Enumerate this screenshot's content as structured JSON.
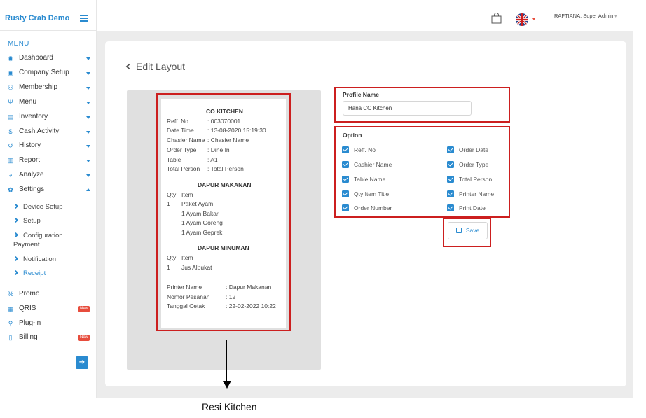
{
  "app": {
    "brand": "Rusty Crab Demo"
  },
  "sidebar": {
    "menu_title": "MENU",
    "items": [
      {
        "label": "Dashboard",
        "icon": "dashboard-icon"
      },
      {
        "label": "Company Setup",
        "icon": "building-icon"
      },
      {
        "label": "Membership",
        "icon": "users-icon"
      },
      {
        "label": "Menu",
        "icon": "cutlery-icon"
      },
      {
        "label": "Inventory",
        "icon": "inventory-icon"
      },
      {
        "label": "Cash Activity",
        "icon": "dollar-icon"
      },
      {
        "label": "History",
        "icon": "history-icon"
      },
      {
        "label": "Report",
        "icon": "report-icon"
      },
      {
        "label": "Analyze",
        "icon": "pie-chart-icon"
      },
      {
        "label": "Settings",
        "icon": "gear-icon"
      }
    ],
    "settings_sub": [
      "Device Setup",
      "Setup",
      "Configuration",
      "Payment",
      "Notification",
      "Receipt"
    ],
    "bottom_items": [
      {
        "label": "Promo",
        "icon": "percent-icon"
      },
      {
        "label": "QRIS",
        "icon": "qr-icon",
        "badge": "New"
      },
      {
        "label": "Plug-in",
        "icon": "plug-icon"
      },
      {
        "label": "Billing",
        "icon": "billing-icon",
        "badge": "New"
      }
    ]
  },
  "topbar": {
    "user": "RAFTIANA, Super Admin"
  },
  "page": {
    "title": "Edit Layout"
  },
  "receipt": {
    "title": "CO KITCHEN",
    "fields": [
      {
        "k": "Reff. No",
        "v": ": 003070001"
      },
      {
        "k": "Date Time",
        "v": ": 13-08-2020 15:19:30"
      },
      {
        "k": "Chasier Name",
        "v": ": Chasier Name"
      },
      {
        "k": "Order Type",
        "v": ": Dine In"
      },
      {
        "k": "Table",
        "v": ": A1"
      },
      {
        "k": "Total Person",
        "v": ": Total Person"
      }
    ],
    "section1": "DAPUR MAKANAN",
    "qty_header": "Qty",
    "item_header": "Item",
    "s1_qty": "1",
    "s1_item": "Paket Ayam",
    "s1_subitems": [
      "1 Ayam Bakar",
      "1 Ayam Goreng",
      "1 Ayam Geprek"
    ],
    "section2": "DAPUR MINUMAN",
    "s2_qty": "1",
    "s2_item": "Jus Alpukat",
    "footer": [
      {
        "k": "Printer Name",
        "v": ": Dapur Makanan"
      },
      {
        "k": "Nomor Pesanan",
        "v": ": 12"
      },
      {
        "k": "Tanggal Cetak",
        "v": ": 22-02-2022 10:22"
      }
    ]
  },
  "profile": {
    "label": "Profile Name",
    "value": "Hana CO Kitchen"
  },
  "option": {
    "label": "Option",
    "left": [
      "Reff. No",
      "Cashier Name",
      "Table Name",
      "Qty Item Title",
      "Order Number"
    ],
    "right": [
      "Order Date",
      "Order Type",
      "Total Person",
      "Printer Name",
      "Print Date"
    ]
  },
  "save_label": "Save",
  "annotation": "Resi Kitchen",
  "colors": {
    "accent": "#2a8bd0",
    "highlight": "#cc1f1f",
    "badge": "#e74c3c"
  }
}
